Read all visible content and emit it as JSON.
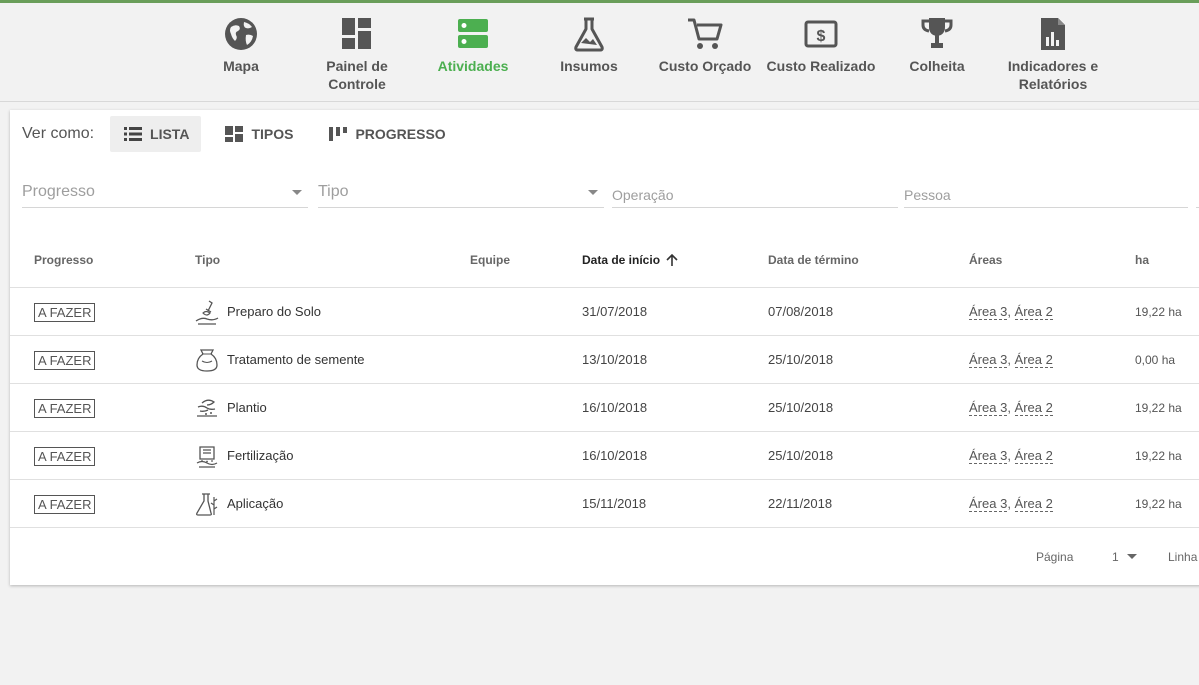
{
  "nav": {
    "items": [
      {
        "label": "Mapa",
        "icon": "globe-icon"
      },
      {
        "label": "Painel de Controle",
        "icon": "dashboard-icon"
      },
      {
        "label": "Atividades",
        "icon": "activities-icon",
        "active": true
      },
      {
        "label": "Insumos",
        "icon": "flask-icon"
      },
      {
        "label": "Custo Orçado",
        "icon": "cart-icon"
      },
      {
        "label": "Custo Realizado",
        "icon": "money-icon"
      },
      {
        "label": "Colheita",
        "icon": "trophy-icon"
      },
      {
        "label": "Indicadores e Relatórios",
        "icon": "report-icon"
      }
    ],
    "active_color": "#4caf50"
  },
  "view": {
    "label": "Ver como:",
    "options": [
      "LISTA",
      "TIPOS",
      "PROGRESSO"
    ],
    "selected": "LISTA"
  },
  "filters": {
    "progresso": "Progresso",
    "tipo": "Tipo",
    "operacao": "Operação",
    "pessoa": "Pessoa"
  },
  "table": {
    "columns": [
      "Progresso",
      "Tipo",
      "Equipe",
      "Data de início",
      "Data de término",
      "Áreas",
      "ha"
    ],
    "sorted_column": "Data de início",
    "rows": [
      {
        "progresso": "A FAZER",
        "tipo": "Preparo do Solo",
        "icon": "soil-prep-icon",
        "equipe": "",
        "inicio": "31/07/2018",
        "termino": "07/08/2018",
        "area1": "Área 3",
        "area2": "Área 2",
        "ha": "19,22 ha"
      },
      {
        "progresso": "A FAZER",
        "tipo": "Tratamento de semente",
        "icon": "seed-bag-icon",
        "equipe": "",
        "inicio": "13/10/2018",
        "termino": "25/10/2018",
        "area1": "Área 3",
        "area2": "Área 2",
        "ha": "0,00 ha"
      },
      {
        "progresso": "A FAZER",
        "tipo": "Plantio",
        "icon": "planting-icon",
        "equipe": "",
        "inicio": "16/10/2018",
        "termino": "25/10/2018",
        "area1": "Área 3",
        "area2": "Área 2",
        "ha": "19,22 ha"
      },
      {
        "progresso": "A FAZER",
        "tipo": "Fertilização",
        "icon": "fertilizer-icon",
        "equipe": "",
        "inicio": "16/10/2018",
        "termino": "25/10/2018",
        "area1": "Área 3",
        "area2": "Área 2",
        "ha": "19,22 ha"
      },
      {
        "progresso": "A FAZER",
        "tipo": "Aplicação",
        "icon": "application-icon",
        "equipe": "",
        "inicio": "15/11/2018",
        "termino": "22/11/2018",
        "area1": "Área 3",
        "area2": "Área 2",
        "ha": "19,22 ha"
      }
    ]
  },
  "pagination": {
    "page_label": "Página",
    "page": "1",
    "rows_label": "Linha"
  }
}
